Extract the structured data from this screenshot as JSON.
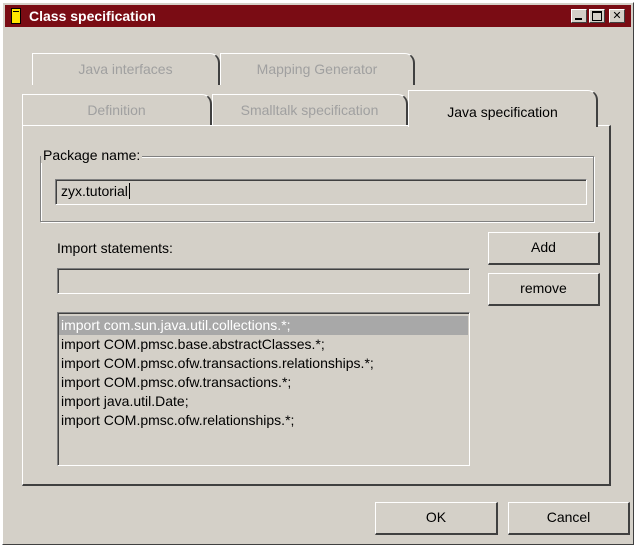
{
  "window": {
    "title": "Class specification",
    "minimize_icon": "minimize-icon",
    "maximize_icon": "maximize-icon",
    "close_icon": "close-icon",
    "close_glyph": "✕"
  },
  "tabs": {
    "back_row": [
      "Java interfaces",
      "Mapping Generator"
    ],
    "front_row": [
      "Definition",
      "Smalltalk specification",
      "Java specification"
    ],
    "active": "Java specification"
  },
  "package": {
    "legend": "Package name:",
    "value": "zyx.tutorial"
  },
  "imports": {
    "label": "Import statements:",
    "input_value": "",
    "add_label": "Add",
    "remove_label": "remove",
    "items": [
      "import com.sun.java.util.collections.*;",
      "import COM.pmsc.base.abstractClasses.*;",
      "import COM.pmsc.ofw.transactions.relationships.*;",
      "import COM.pmsc.ofw.transactions.*;",
      "import java.util.Date;",
      "import COM.pmsc.ofw.relationships.*;"
    ],
    "selected_index": 0
  },
  "footer": {
    "ok_label": "OK",
    "cancel_label": "Cancel"
  }
}
